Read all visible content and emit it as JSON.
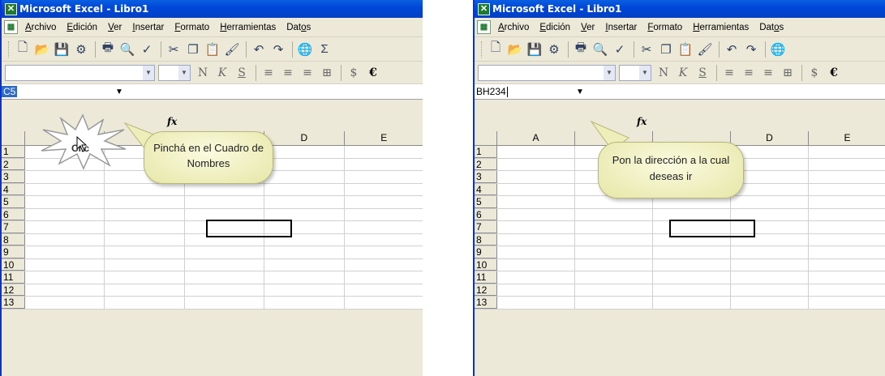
{
  "window_title": "Microsoft Excel - Libro1",
  "menu": [
    "Archivo",
    "Edición",
    "Ver",
    "Insertar",
    "Formato",
    "Herramientas",
    "Datos"
  ],
  "menu_underline": [
    "A",
    "E",
    "V",
    "I",
    "F",
    "H",
    "o"
  ],
  "formula_icon": "fx",
  "columns_left": [
    "",
    "",
    "",
    "D",
    "E"
  ],
  "columns_right": [
    "A",
    "",
    "",
    "D",
    "E"
  ],
  "rows": [
    "1",
    "2",
    "3",
    "4",
    "5",
    "6",
    "7",
    "8",
    "9",
    "10",
    "11",
    "12",
    "13"
  ],
  "left": {
    "name_box_value": "C5",
    "clic_label": "Clic",
    "callout_text": "Pinchá en el Cuadro de Nombres"
  },
  "right": {
    "name_box_value": "BH234",
    "callout_text": "Pon la dirección a la cual deseas ir"
  },
  "colors": {
    "titlebar": "#0046d8",
    "callout": "#f5f5c8",
    "name_selection": "#316ac5"
  }
}
